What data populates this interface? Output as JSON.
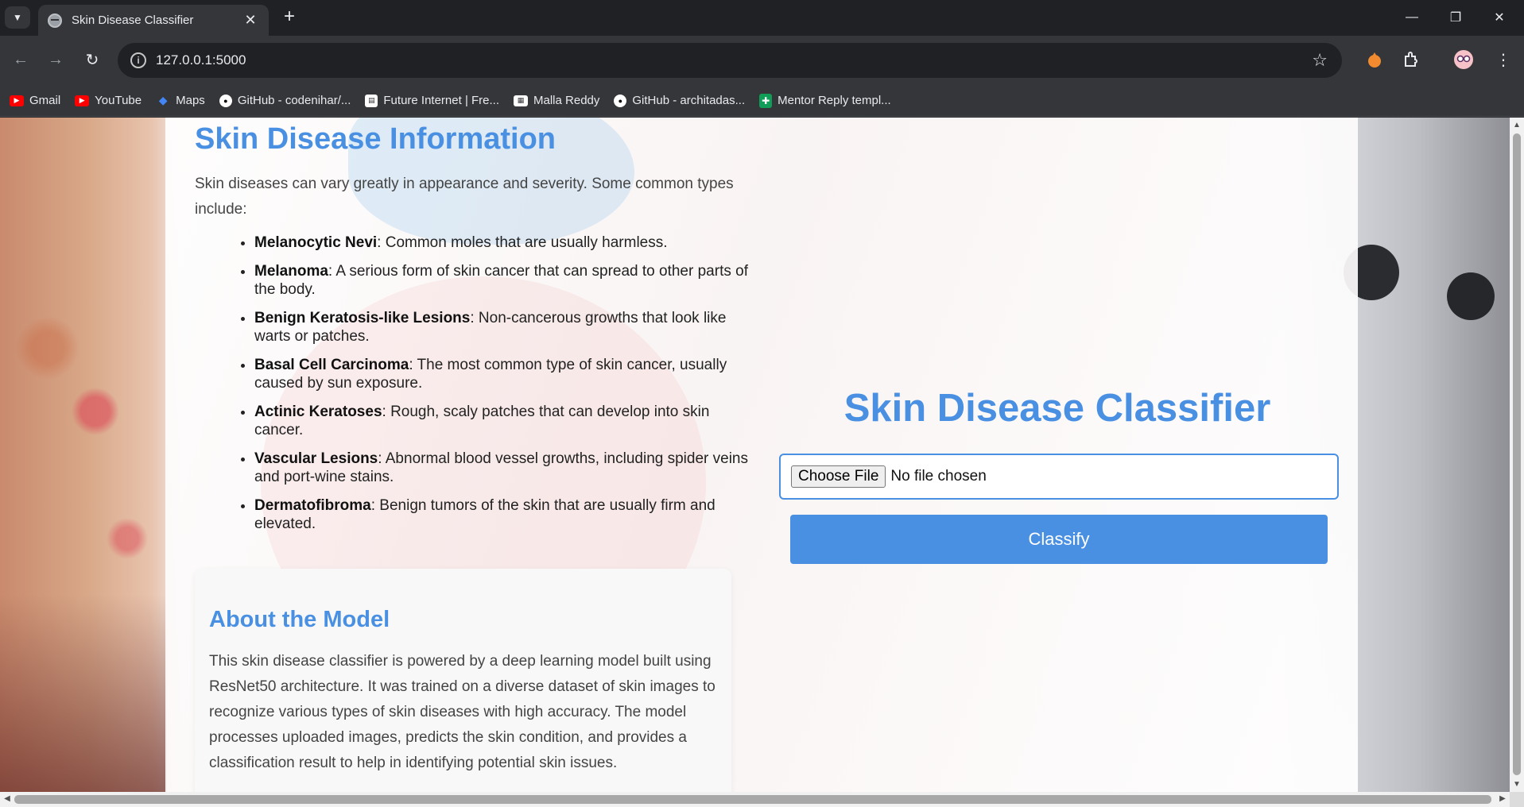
{
  "browser": {
    "tab_title": "Skin Disease Classifier",
    "tab_close": "✕",
    "new_tab": "+",
    "url": "127.0.0.1:5000",
    "window_controls": {
      "minimize": "—",
      "restore": "❐",
      "close": "✕"
    },
    "bookmarks": [
      {
        "label": "Gmail",
        "icon": "gmail-icon",
        "color": "#ea4335"
      },
      {
        "label": "YouTube",
        "icon": "youtube-icon",
        "color": "#ff0000"
      },
      {
        "label": "Maps",
        "icon": "maps-icon",
        "color": "#4285f4"
      },
      {
        "label": "GitHub - codenihar/...",
        "icon": "github-icon",
        "color": "#ffffff"
      },
      {
        "label": "Future Internet | Fre...",
        "icon": "mdpi-icon",
        "color": "#ffffff"
      },
      {
        "label": "Malla Reddy",
        "icon": "college-icon",
        "color": "#ffffff"
      },
      {
        "label": "GitHub - architadas...",
        "icon": "github-icon",
        "color": "#ffffff"
      },
      {
        "label": "Mentor Reply templ...",
        "icon": "sheets-icon",
        "color": "#0f9d58"
      }
    ]
  },
  "info": {
    "title": "Skin Disease Information",
    "intro": "Skin diseases can vary greatly in appearance and severity. Some common types include:",
    "diseases": [
      {
        "name": "Melanocytic Nevi",
        "desc": ": Common moles that are usually harmless."
      },
      {
        "name": "Melanoma",
        "desc": ": A serious form of skin cancer that can spread to other parts of the body."
      },
      {
        "name": "Benign Keratosis-like Lesions",
        "desc": ": Non-cancerous growths that look like warts or patches."
      },
      {
        "name": "Basal Cell Carcinoma",
        "desc": ": The most common type of skin cancer, usually caused by sun exposure."
      },
      {
        "name": "Actinic Keratoses",
        "desc": ": Rough, scaly patches that can develop into skin cancer."
      },
      {
        "name": "Vascular Lesions",
        "desc": ": Abnormal blood vessel growths, including spider veins and port-wine stains."
      },
      {
        "name": "Dermatofibroma",
        "desc": ": Benign tumors of the skin that are usually firm and elevated."
      }
    ]
  },
  "about": {
    "title": "About the Model",
    "text": "This skin disease classifier is powered by a deep learning model built using ResNet50 architecture. It was trained on a diverse dataset of skin images to recognize various types of skin diseases with high accuracy. The model processes uploaded images, predicts the skin condition, and provides a classification result to help in identifying potential skin issues."
  },
  "classifier": {
    "title": "Skin Disease Classifier",
    "choose_file_label": "Choose File",
    "file_status": "No file chosen",
    "classify_label": "Classify"
  },
  "colors": {
    "accent": "#4a90e2",
    "chrome_dark": "#202124",
    "chrome_toolbar": "#35363a"
  }
}
